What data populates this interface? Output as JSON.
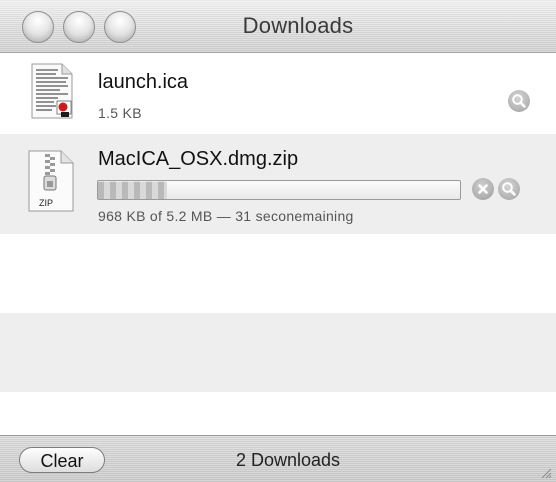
{
  "window": {
    "title": "Downloads"
  },
  "downloads": [
    {
      "name": "launch.ica",
      "size": "1.5 KB",
      "icon": "text-document-icon",
      "status": "completed"
    },
    {
      "name": "MacICA_OSX.dmg.zip",
      "progress_text": "968 KB of 5.2 MB — 31 seconemaining",
      "progress_fraction": 0.19,
      "icon": "zip-archive-icon",
      "icon_label": "ZIP",
      "status": "downloading"
    }
  ],
  "footer": {
    "clear_label": "Clear",
    "count_text": "2 Downloads"
  }
}
